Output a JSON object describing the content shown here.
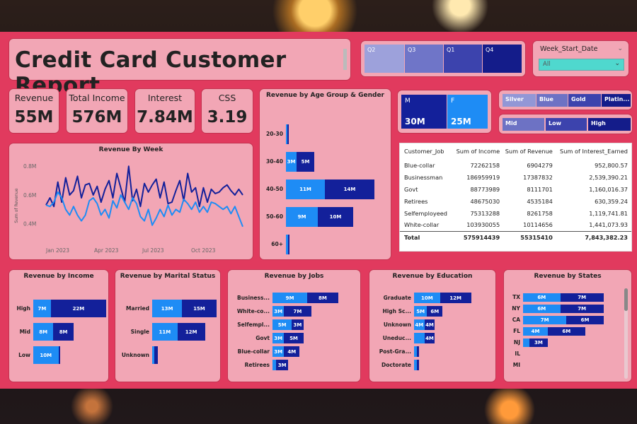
{
  "title": "Credit Card Customer Report",
  "quarter_slicer": [
    "Q2",
    "Q3",
    "Q1",
    "Q4"
  ],
  "week_slicer": {
    "label": "Week_Start_Date",
    "value": "All"
  },
  "kpis": [
    {
      "label": "Revenue",
      "value": "55M"
    },
    {
      "label": "Total Income",
      "value": "576M"
    },
    {
      "label": "Interest",
      "value": "7.84M"
    },
    {
      "label": "CSS",
      "value": "3.19"
    }
  ],
  "gender_cards": [
    {
      "label": "M",
      "value": "30M"
    },
    {
      "label": "F",
      "value": "25M"
    }
  ],
  "card_slicer": [
    "Silver",
    "Blue",
    "Gold",
    "Platin..."
  ],
  "income_slicer": [
    "Mid",
    "Low",
    "High"
  ],
  "colors": {
    "primary": "#1e8cf5",
    "secondary": "#13209a",
    "background": "#e13a5e",
    "card": "#f2a6b5"
  },
  "job_table": {
    "headers": [
      "Customer_Job",
      "Sum of Income",
      "Sum of Revenue",
      "Sum of Interest_Earned"
    ],
    "rows": [
      [
        "Blue-collar",
        "72262158",
        "6904279",
        "952,800.57"
      ],
      [
        "Businessman",
        "186959919",
        "17387832",
        "2,539,390.21"
      ],
      [
        "Govt",
        "88773989",
        "8111701",
        "1,160,016.37"
      ],
      [
        "Retirees",
        "48675030",
        "4535184",
        "630,359.24"
      ],
      [
        "Selfemployeed",
        "75313288",
        "8261758",
        "1,119,741.81"
      ],
      [
        "White-collar",
        "103930055",
        "10114656",
        "1,441,073.93"
      ]
    ],
    "total": [
      "Total",
      "575914439",
      "55315410",
      "7,843,382.23"
    ]
  },
  "chart_data": [
    {
      "type": "line",
      "title": "Revenue By Week",
      "ylabel": "Sum of Revenue",
      "xlabel": "",
      "y_ticks": [
        "0.8M",
        "0.6M",
        "0.4M"
      ],
      "x_ticks": [
        "Jan 2023",
        "Apr 2023",
        "Jul 2023",
        "Oct 2023"
      ],
      "ylim": [
        0.3,
        0.85
      ],
      "series": [
        {
          "color": "#13209a",
          "values": [
            0.53,
            0.58,
            0.52,
            0.69,
            0.55,
            0.72,
            0.6,
            0.63,
            0.73,
            0.58,
            0.67,
            0.68,
            0.6,
            0.66,
            0.55,
            0.64,
            0.7,
            0.58,
            0.75,
            0.65,
            0.55,
            0.8,
            0.56,
            0.64,
            0.52,
            0.68,
            0.62,
            0.67,
            0.71,
            0.58,
            0.69,
            0.54,
            0.55,
            0.63,
            0.7,
            0.56,
            0.75,
            0.62,
            0.65,
            0.52,
            0.65,
            0.55,
            0.64,
            0.61,
            0.62,
            0.65,
            0.67,
            0.63,
            0.6,
            0.64,
            0.6
          ]
        },
        {
          "color": "#1e8cf5",
          "values": [
            0.53,
            0.52,
            0.55,
            0.62,
            0.58,
            0.5,
            0.46,
            0.52,
            0.46,
            0.42,
            0.46,
            0.56,
            0.58,
            0.54,
            0.46,
            0.5,
            0.44,
            0.56,
            0.51,
            0.6,
            0.55,
            0.5,
            0.58,
            0.54,
            0.45,
            0.42,
            0.5,
            0.39,
            0.44,
            0.5,
            0.45,
            0.53,
            0.46,
            0.5,
            0.48,
            0.57,
            0.54,
            0.5,
            0.55,
            0.48,
            0.52,
            0.48,
            0.55,
            0.54,
            0.52,
            0.5,
            0.52,
            0.47,
            0.52,
            0.45,
            0.38
          ]
        }
      ]
    },
    {
      "type": "bar",
      "orientation": "horizontal",
      "title": "Revenue by Age Group & Gender",
      "categories": [
        "20-30",
        "30-40",
        "40-50",
        "50-60",
        "60+"
      ],
      "series": [
        {
          "values": [
            0.2,
            3,
            11,
            9,
            0.6
          ],
          "labels": [
            "",
            "3M",
            "11M",
            "9M",
            ""
          ]
        },
        {
          "values": [
            0.1,
            5,
            14,
            10,
            0.4
          ],
          "labels": [
            "",
            "5M",
            "14M",
            "10M",
            ""
          ]
        }
      ],
      "max": 28
    },
    {
      "type": "bar",
      "orientation": "horizontal",
      "title": "Revenue by Income",
      "categories": [
        "High",
        "Mid",
        "Low"
      ],
      "series": [
        {
          "values": [
            7,
            8,
            10
          ],
          "labels": [
            "7M",
            "8M",
            "10M"
          ]
        },
        {
          "values": [
            22,
            8,
            0.3
          ],
          "labels": [
            "22M",
            "8M",
            ""
          ]
        }
      ],
      "max": 29
    },
    {
      "type": "bar",
      "orientation": "horizontal",
      "title": "Revenue by Marital Status",
      "categories": [
        "Married",
        "Single",
        "Unknown"
      ],
      "series": [
        {
          "values": [
            13,
            11,
            1
          ],
          "labels": [
            "13M",
            "11M",
            ""
          ]
        },
        {
          "values": [
            15,
            12,
            1.5
          ],
          "labels": [
            "15M",
            "12M",
            ""
          ]
        }
      ],
      "max": 29
    },
    {
      "type": "bar",
      "orientation": "horizontal",
      "title": "Revenue by Jobs",
      "categories": [
        "Business...",
        "White-co...",
        "Selfempl...",
        "Govt",
        "Blue-collar",
        "Retirees"
      ],
      "series": [
        {
          "values": [
            9,
            3,
            5,
            3,
            3,
            1
          ],
          "labels": [
            "9M",
            "3M",
            "5M",
            "3M",
            "3M",
            ""
          ]
        },
        {
          "values": [
            8,
            7,
            3,
            5,
            4,
            3
          ],
          "labels": [
            "8M",
            "7M",
            "3M",
            "5M",
            "4M",
            "3M"
          ]
        }
      ],
      "max": 22
    },
    {
      "type": "bar",
      "orientation": "horizontal",
      "title": "Revenue by Education",
      "categories": [
        "Graduate",
        "High Sc...",
        "Unknown",
        "Uneduc...",
        "Post-Gra...",
        "Doctorate"
      ],
      "series": [
        {
          "values": [
            10,
            5,
            4,
            4,
            1,
            1
          ],
          "labels": [
            "10M",
            "5M",
            "4M",
            "",
            ""
          ]
        },
        {
          "values": [
            12,
            6,
            4,
            4,
            1,
            1
          ],
          "labels": [
            "12M",
            "6M",
            "4M",
            "4M",
            "",
            ""
          ]
        }
      ],
      "max": 30
    },
    {
      "type": "bar",
      "orientation": "horizontal",
      "title": "Revenue by States",
      "categories": [
        "TX",
        "NY",
        "CA",
        "FL",
        "NJ",
        "IL",
        "MI"
      ],
      "series": [
        {
          "values": [
            6,
            6,
            7,
            4,
            1,
            0,
            0
          ],
          "labels": [
            "6M",
            "6M",
            "7M",
            "4M",
            "",
            "",
            ""
          ]
        },
        {
          "values": [
            7,
            7,
            6,
            6,
            3,
            0,
            0
          ],
          "labels": [
            "7M",
            "7M",
            "6M",
            "6M",
            "3M",
            "",
            ""
          ]
        }
      ],
      "max": 16
    }
  ]
}
